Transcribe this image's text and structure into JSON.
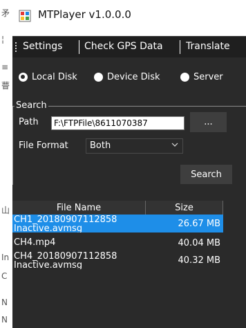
{
  "window": {
    "title": "MTPlayer v1.0.0.0"
  },
  "menu": {
    "items": [
      {
        "label": "Settings"
      },
      {
        "label": "Check GPS Data"
      },
      {
        "label": "Translate"
      }
    ]
  },
  "source": {
    "options": [
      {
        "label": "Local Disk",
        "checked": true
      },
      {
        "label": "Device Disk",
        "checked": false
      },
      {
        "label": "Server",
        "checked": false
      }
    ]
  },
  "search": {
    "group_title": "Search",
    "path_label": "Path",
    "path_value": "F:\\FTPFile\\8611070387",
    "browse_label": "...",
    "format_label": "File Format",
    "format_value": "Both",
    "search_label": "Search"
  },
  "table": {
    "headers": {
      "name": "File Name",
      "size": "Size"
    },
    "rows": [
      {
        "name": "CH1_20180907112858\nInactive.avmsg",
        "size": "26.67 MB",
        "selected": true
      },
      {
        "name": "CH4.mp4",
        "size": "40.04 MB",
        "selected": false
      },
      {
        "name": "CH4_20180907112858\nInactive.avmsg",
        "size": "40.32 MB",
        "selected": false
      }
    ]
  },
  "colors": {
    "accent": "#1e8ee8",
    "panel": "#2a2a2a",
    "menubar": "#1f1f1f"
  }
}
